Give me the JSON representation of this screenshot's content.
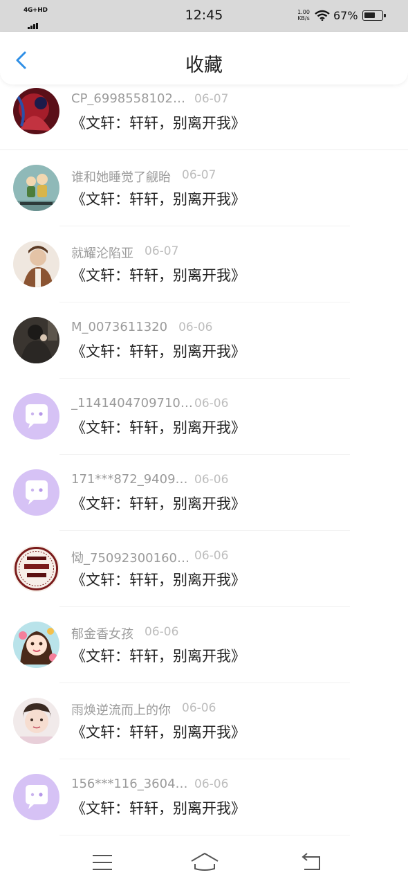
{
  "status_bar": {
    "network": "4G+HD",
    "time": "12:45",
    "speed_value": "1.00",
    "speed_unit": "KB/s",
    "battery_pct": "67%",
    "battery_level": 0.67,
    "icons": [
      "signal-icon",
      "wifi-icon",
      "battery-icon"
    ]
  },
  "header": {
    "title": "收藏",
    "back_icon": "chevron-left-icon",
    "accent": "#2f8fe6"
  },
  "items": [
    {
      "user": "CP_6998558102…",
      "date": "06-07",
      "title": "《文轩：轩轩，别离开我》",
      "avatar": "photo-red"
    },
    {
      "user": "谁和她睡觉了觎眙",
      "date": "06-07",
      "title": "《文轩：轩轩，别离开我》",
      "avatar": "illustration-kids"
    },
    {
      "user": "就耀沦陷亚",
      "date": "06-07",
      "title": "《文轩：轩轩，别离开我》",
      "avatar": "photo-boy"
    },
    {
      "user": "M_0073611320",
      "date": "06-06",
      "title": "《文轩：轩轩，别离开我》",
      "avatar": "photo-dark"
    },
    {
      "user": "_1141404709710…",
      "date": "06-06",
      "title": "《文轩：轩轩，别离开我》",
      "avatar": "default-chat"
    },
    {
      "user": "171***872_9409…",
      "date": "06-06",
      "title": "《文轩：轩轩，别离开我》",
      "avatar": "default-chat"
    },
    {
      "user": "恸_75092300160…",
      "date": "06-06",
      "title": "《文轩：轩轩，别离开我》",
      "avatar": "seal-art"
    },
    {
      "user": "郁金香女孩",
      "date": "06-06",
      "title": "《文轩：轩轩，别离开我》",
      "avatar": "illustration-girl"
    },
    {
      "user": "雨焕逆流而上的你",
      "date": "06-06",
      "title": "《文轩：轩轩，别离开我》",
      "avatar": "photo-face"
    },
    {
      "user": "156***116_3604…",
      "date": "06-06",
      "title": "《文轩：轩轩，别离开我》",
      "avatar": "default-chat"
    }
  ],
  "nav_bar": {
    "icons": [
      "menu-icon",
      "home-icon",
      "back-icon"
    ]
  }
}
